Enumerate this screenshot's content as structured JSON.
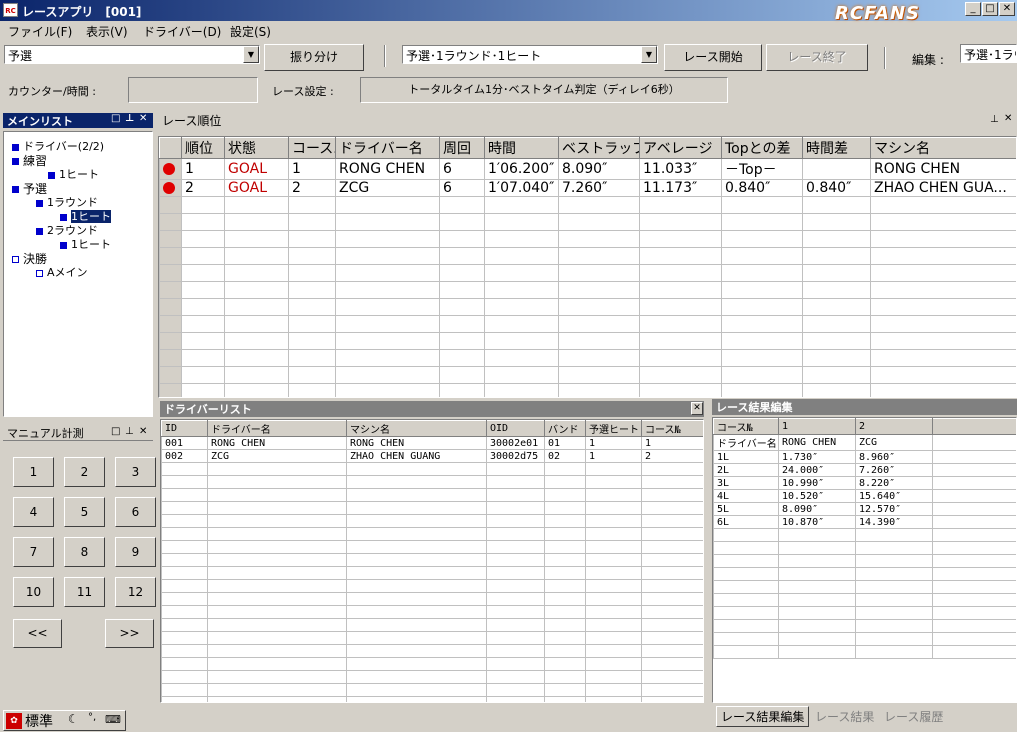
{
  "window": {
    "title": "レースアプリ　[001]",
    "icon_text": "RC",
    "logo": "RCFANS"
  },
  "menu": [
    "ファイル(F)",
    "表示(V)",
    "ドライバー(D)",
    "設定(S)"
  ],
  "toolbar": {
    "category_value": "予選",
    "assign_label": "振り分け",
    "heat_value": "予選･1ラウンド･1ヒート",
    "start_label": "レース開始",
    "end_label": "レース終了",
    "edit_label": "編集 :",
    "edit_value": "予選･1ラウ",
    "counter_label": "カウンター/時間 :",
    "counter_value": "",
    "settings_label": "レース設定 :",
    "settings_value": "トータルタイム1分･ベストタイム判定（ディレイ6秒）"
  },
  "main_list": {
    "title": "メインリスト",
    "nodes": [
      {
        "label": "ドライバー(2/2)",
        "level": 1,
        "type": "filled"
      },
      {
        "label": "練習",
        "level": 1,
        "type": "filled"
      },
      {
        "label": "1ヒート",
        "level": 2,
        "type": "filled"
      },
      {
        "label": "予選",
        "level": 1,
        "type": "filled"
      },
      {
        "label": "1ラウンド",
        "level": 2,
        "type": "filled"
      },
      {
        "label": "1ヒート",
        "level": 3,
        "type": "filled",
        "selected": true
      },
      {
        "label": "2ラウンド",
        "level": 2,
        "type": "filled"
      },
      {
        "label": "1ヒート",
        "level": 3,
        "type": "filled"
      },
      {
        "label": "決勝",
        "level": 1,
        "type": "empty"
      },
      {
        "label": "Aメイン",
        "level": 2,
        "type": "empty"
      }
    ]
  },
  "race_order": {
    "title": "レース順位",
    "columns": [
      "",
      "順位",
      "状態",
      "コース...",
      "ドライバー名",
      "周回",
      "時間",
      "ベストラップ",
      "アベレージ",
      "Topとの差",
      "時間差",
      "マシン名"
    ],
    "rows": [
      [
        "",
        "1",
        "GOAL",
        "1",
        "RONG CHEN",
        "6",
        "1′06.200″",
        "8.090″",
        "11.033″",
        "－Top－",
        "",
        "RONG CHEN"
      ],
      [
        "",
        "2",
        "GOAL",
        "2",
        "ZCG",
        "6",
        "1′07.040″",
        "7.260″",
        "11.173″",
        "0.840″",
        "0.840″",
        "ZHAO CHEN GUA..."
      ]
    ]
  },
  "manual": {
    "title": "マニュアル計測",
    "keys": [
      "1",
      "2",
      "3",
      "4",
      "5",
      "6",
      "7",
      "8",
      "9",
      "10",
      "11",
      "12"
    ],
    "prev": "<<",
    "next": ">>"
  },
  "driver_list": {
    "title": "ドライバーリスト",
    "columns": [
      "ID",
      "ドライバー名",
      "マシン名",
      "OID",
      "バンド",
      "予選ヒート",
      "コース№"
    ],
    "rows": [
      [
        "001",
        "RONG CHEN",
        "RONG CHEN",
        "30002e01",
        "01",
        "1",
        "1"
      ],
      [
        "002",
        "ZCG",
        "ZHAO CHEN GUANG",
        "30002d75",
        "02",
        "1",
        "2"
      ]
    ]
  },
  "result_edit": {
    "title": "レース結果編集",
    "columns": [
      "コース№",
      "1",
      "2"
    ],
    "rows": [
      [
        "ドライバー名",
        "RONG CHEN",
        "ZCG"
      ],
      [
        "1L",
        "1.730″",
        "8.960″"
      ],
      [
        "2L",
        "24.000″",
        "7.260″"
      ],
      [
        "3L",
        "10.990″",
        "8.220″"
      ],
      [
        "4L",
        "10.520″",
        "15.640″"
      ],
      [
        "5L",
        "8.090″",
        "12.570″"
      ],
      [
        "6L",
        "10.870″",
        "14.390″"
      ]
    ],
    "tabs": [
      "レース結果編集",
      "レース結果",
      "レース履歴"
    ]
  },
  "ime": {
    "mode": "標準"
  }
}
